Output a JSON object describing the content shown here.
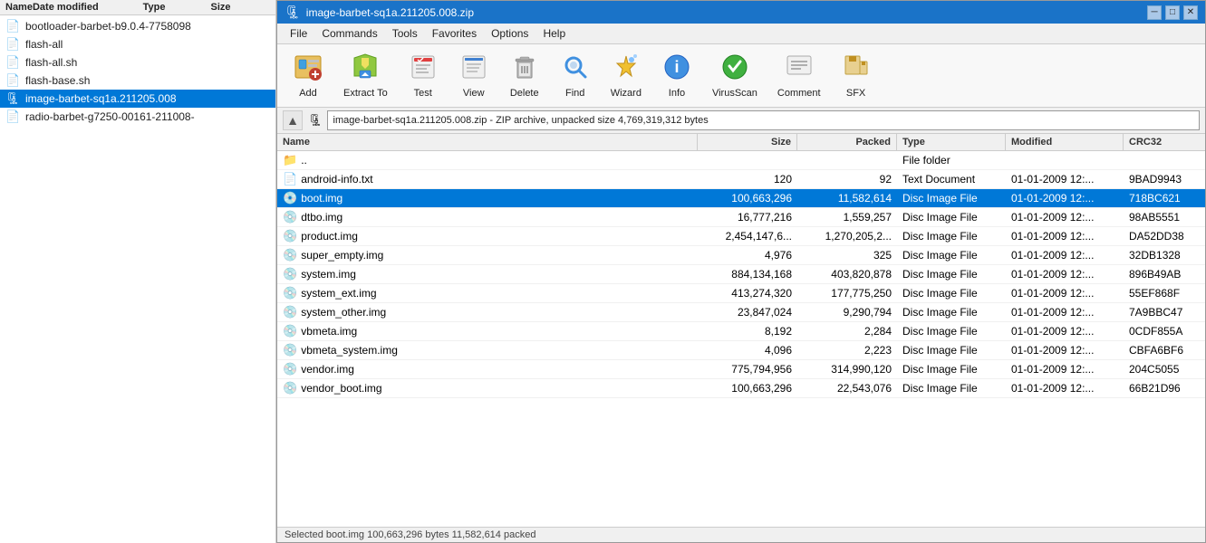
{
  "leftPanel": {
    "columns": {
      "name": "Name",
      "dateModified": "Date modified",
      "type": "Type",
      "size": "Size"
    },
    "items": [
      {
        "id": "bootloader",
        "icon": "📄",
        "name": "bootloader-barbet-b9.0.4-7758098",
        "selected": false
      },
      {
        "id": "flash-all",
        "icon": "📄",
        "name": "flash-all",
        "selected": false
      },
      {
        "id": "flash-all-sh",
        "icon": "📄",
        "name": "flash-all.sh",
        "selected": false
      },
      {
        "id": "flash-base-sh",
        "icon": "📄",
        "name": "flash-base.sh",
        "selected": false
      },
      {
        "id": "image-barbet",
        "icon": "🗜",
        "name": "image-barbet-sq1a.211205.008",
        "selected": true
      },
      {
        "id": "radio-barbet",
        "icon": "📄",
        "name": "radio-barbet-g7250-00161-211008-",
        "selected": false
      }
    ]
  },
  "winrar": {
    "titleBar": {
      "title": "image-barbet-sq1a.211205.008.zip",
      "icon": "🗜"
    },
    "menuBar": {
      "items": [
        "File",
        "Commands",
        "Tools",
        "Favorites",
        "Options",
        "Help"
      ]
    },
    "toolbar": {
      "buttons": [
        {
          "id": "add",
          "icon": "🗜",
          "label": "Add"
        },
        {
          "id": "extract-to",
          "icon": "📂",
          "label": "Extract To"
        },
        {
          "id": "test",
          "icon": "📋",
          "label": "Test"
        },
        {
          "id": "view",
          "icon": "📄",
          "label": "View"
        },
        {
          "id": "delete",
          "icon": "🗑",
          "label": "Delete"
        },
        {
          "id": "find",
          "icon": "🔍",
          "label": "Find"
        },
        {
          "id": "wizard",
          "icon": "✨",
          "label": "Wizard"
        },
        {
          "id": "info",
          "icon": "ℹ",
          "label": "Info"
        },
        {
          "id": "virusscan",
          "icon": "🛡",
          "label": "VirusScan"
        },
        {
          "id": "comment",
          "icon": "📃",
          "label": "Comment"
        },
        {
          "id": "sfx",
          "icon": "📚",
          "label": "SFX"
        }
      ]
    },
    "addressBar": {
      "path": "image-barbet-sq1a.211205.008.zip - ZIP archive, unpacked size 4,769,319,312 bytes"
    },
    "fileList": {
      "columns": {
        "name": "Name",
        "size": "Size",
        "packed": "Packed",
        "type": "Type",
        "modified": "Modified",
        "crc32": "CRC32"
      },
      "rows": [
        {
          "id": "parent",
          "icon": "📁",
          "name": "..",
          "size": "",
          "packed": "",
          "type": "File folder",
          "modified": "",
          "crc32": "",
          "selected": false
        },
        {
          "id": "android-info",
          "icon": "📄",
          "name": "android-info.txt",
          "size": "120",
          "packed": "92",
          "type": "Text Document",
          "modified": "01-01-2009 12:...",
          "crc32": "9BAD9943",
          "selected": false
        },
        {
          "id": "boot",
          "icon": "💿",
          "name": "boot.img",
          "size": "100,663,296",
          "packed": "11,582,614",
          "type": "Disc Image File",
          "modified": "01-01-2009 12:...",
          "crc32": "718BC621",
          "selected": true
        },
        {
          "id": "dtbo",
          "icon": "💿",
          "name": "dtbo.img",
          "size": "16,777,216",
          "packed": "1,559,257",
          "type": "Disc Image File",
          "modified": "01-01-2009 12:...",
          "crc32": "98AB5551",
          "selected": false
        },
        {
          "id": "product",
          "icon": "💿",
          "name": "product.img",
          "size": "2,454,147,6...",
          "packed": "1,270,205,2...",
          "type": "Disc Image File",
          "modified": "01-01-2009 12:...",
          "crc32": "DA52DD38",
          "selected": false
        },
        {
          "id": "super_empty",
          "icon": "💿",
          "name": "super_empty.img",
          "size": "4,976",
          "packed": "325",
          "type": "Disc Image File",
          "modified": "01-01-2009 12:...",
          "crc32": "32DB1328",
          "selected": false
        },
        {
          "id": "system",
          "icon": "💿",
          "name": "system.img",
          "size": "884,134,168",
          "packed": "403,820,878",
          "type": "Disc Image File",
          "modified": "01-01-2009 12:...",
          "crc32": "896B49AB",
          "selected": false
        },
        {
          "id": "system_ext",
          "icon": "💿",
          "name": "system_ext.img",
          "size": "413,274,320",
          "packed": "177,775,250",
          "type": "Disc Image File",
          "modified": "01-01-2009 12:...",
          "crc32": "55EF868F",
          "selected": false
        },
        {
          "id": "system_other",
          "icon": "💿",
          "name": "system_other.img",
          "size": "23,847,024",
          "packed": "9,290,794",
          "type": "Disc Image File",
          "modified": "01-01-2009 12:...",
          "crc32": "7A9BBC47",
          "selected": false
        },
        {
          "id": "vbmeta",
          "icon": "💿",
          "name": "vbmeta.img",
          "size": "8,192",
          "packed": "2,284",
          "type": "Disc Image File",
          "modified": "01-01-2009 12:...",
          "crc32": "0CDF855A",
          "selected": false
        },
        {
          "id": "vbmeta_system",
          "icon": "💿",
          "name": "vbmeta_system.img",
          "size": "4,096",
          "packed": "2,223",
          "type": "Disc Image File",
          "modified": "01-01-2009 12:...",
          "crc32": "CBFA6BF6",
          "selected": false
        },
        {
          "id": "vendor",
          "icon": "💿",
          "name": "vendor.img",
          "size": "775,794,956",
          "packed": "314,990,120",
          "type": "Disc Image File",
          "modified": "01-01-2009 12:...",
          "crc32": "204C5055",
          "selected": false
        },
        {
          "id": "vendor_boot",
          "icon": "💿",
          "name": "vendor_boot.img",
          "size": "100,663,296",
          "packed": "22,543,076",
          "type": "Disc Image File",
          "modified": "01-01-2009 12:...",
          "crc32": "66B21D96",
          "selected": false
        }
      ]
    },
    "statusBar": {
      "text": "Selected boot.img  100,663,296 bytes  11,582,614 packed"
    }
  }
}
